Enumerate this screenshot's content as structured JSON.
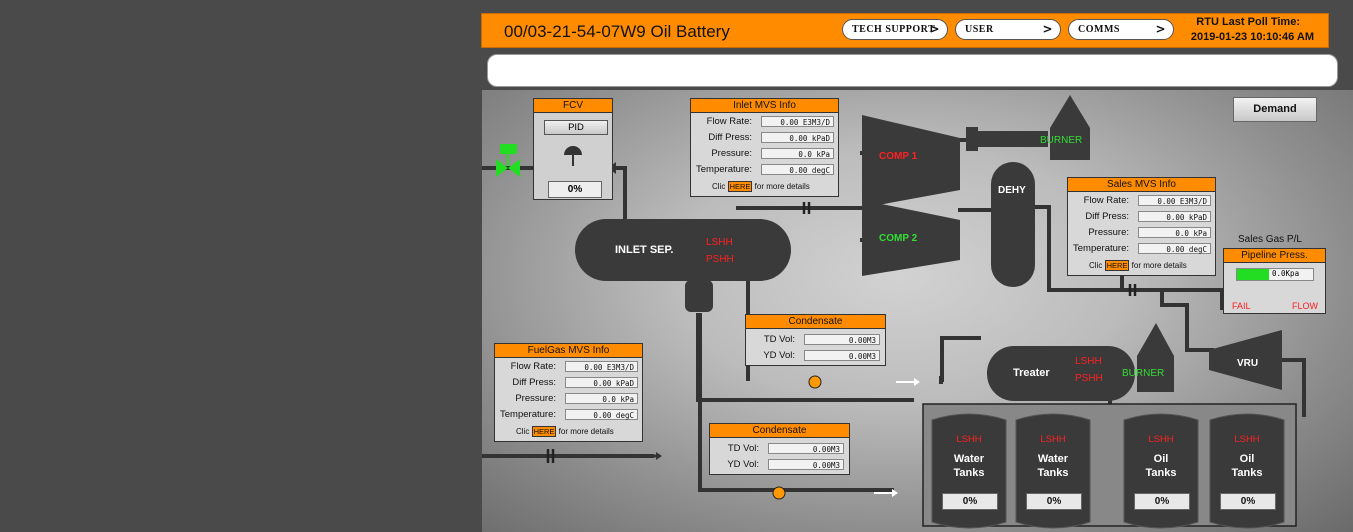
{
  "header": {
    "title": "00/03-21-54-07W9 Oil Battery",
    "nav": [
      {
        "label": "TECH SUPPORT"
      },
      {
        "label": "USER"
      },
      {
        "label": "COMMS"
      }
    ],
    "chevron": ">",
    "poll_label": "RTU Last Poll Time:",
    "poll_time": "2019-01-23 10:10:46 AM"
  },
  "message_bar": {
    "value": ""
  },
  "demand_button": {
    "label": "Demand"
  },
  "fcv": {
    "title": "FCV",
    "pid_label": "PID",
    "value": "0%"
  },
  "inlet_mvs": {
    "title": "Inlet MVS Info",
    "rows": [
      {
        "label": "Flow Rate:",
        "value": "0.00 E3M3/D"
      },
      {
        "label": "Diff Press:",
        "value": "0.00 kPaD"
      },
      {
        "label": "Pressure:",
        "value": "0.0 kPa"
      },
      {
        "label": "Temperature:",
        "value": "0.00 degC"
      }
    ],
    "more_prefix": "Clic",
    "more_link": "HERE",
    "more_suffix": "for more details"
  },
  "sales_mvs": {
    "title": "Sales MVS Info",
    "rows": [
      {
        "label": "Flow Rate:",
        "value": "0.00 E3M3/D"
      },
      {
        "label": "Diff Press:",
        "value": "0.00 kPaD"
      },
      {
        "label": "Pressure:",
        "value": "0.0 kPa"
      },
      {
        "label": "Temperature:",
        "value": "0.00 degC"
      }
    ],
    "more_prefix": "Clic",
    "more_link": "HERE",
    "more_suffix": "for more details"
  },
  "fuelgas_mvs": {
    "title": "FuelGas MVS Info",
    "rows": [
      {
        "label": "Flow Rate:",
        "value": "0.00 E3M3/D"
      },
      {
        "label": "Diff Press:",
        "value": "0.00 kPaD"
      },
      {
        "label": "Pressure:",
        "value": "0.0 kPa"
      },
      {
        "label": "Temperature:",
        "value": "0.00 degC"
      }
    ],
    "more_prefix": "Clic",
    "more_link": "HERE",
    "more_suffix": "for more details"
  },
  "condensate_upper": {
    "title": "Condensate",
    "rows": [
      {
        "label": "TD Vol:",
        "value": "0.00M3"
      },
      {
        "label": "YD Vol:",
        "value": "0.00M3"
      }
    ]
  },
  "condensate_lower": {
    "title": "Condensate",
    "rows": [
      {
        "label": "TD Vol:",
        "value": "0.00M3"
      },
      {
        "label": "YD Vol:",
        "value": "0.00M3"
      }
    ]
  },
  "pipeline": {
    "caption": "Sales Gas P/L",
    "title": "Pipeline Press.",
    "value": "0.0Kpa",
    "bar_fraction": 0.42,
    "fail_label": "FAIL",
    "right_label": "FLOW"
  },
  "equipment": {
    "inlet_sep": "INLET SEP.",
    "lshh": "LSHH",
    "pshh": "PSHH",
    "comp1": "COMP 1",
    "comp2": "COMP 2",
    "burner": "BURNER",
    "dehy": "DEHY",
    "treater": "Treater",
    "vru": "VRU"
  },
  "tanks": [
    {
      "alarm": "LSHH",
      "line1": "Water",
      "line2": "Tanks",
      "value": "0%"
    },
    {
      "alarm": "LSHH",
      "line1": "Water",
      "line2": "Tanks",
      "value": "0%"
    },
    {
      "alarm": "LSHH",
      "line1": "Oil",
      "line2": "Tanks",
      "value": "0%"
    },
    {
      "alarm": "LSHH",
      "line1": "Oil",
      "line2": "Tanks",
      "value": "0%"
    }
  ],
  "colors": {
    "accent": "#ff8c00",
    "alarm": "#ff2020",
    "ok": "#33dd33",
    "equipment": "#3a3a3a"
  }
}
